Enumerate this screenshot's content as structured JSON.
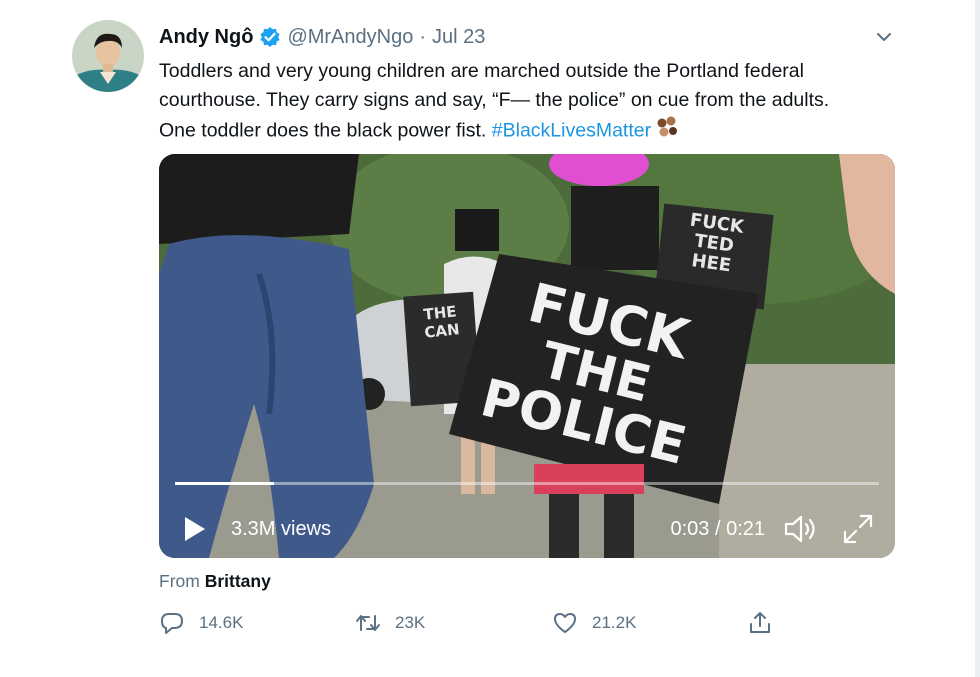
{
  "tweet": {
    "author_name": "Andy Ngô",
    "handle": "@MrAndyNgo",
    "separator": "·",
    "date": "Jul 23",
    "text_line1": "Toddlers and very young children are marched outside the Portland federal",
    "text_line2": "courthouse. They carry signs and say, “F— the police” on cue from the adults.",
    "text_line3_prefix": "One toddler does the black power fist. ",
    "hashtag": "#BlackLivesMatter",
    "emoji": "fist-emoji"
  },
  "video": {
    "sign_text_line1": "FUCK",
    "sign_text_line2": "THE",
    "sign_text_line3": "POLICE",
    "back_sign_line1": "FUCK",
    "back_sign_line2": "TED",
    "back_sign_line3": "HEE",
    "left_sign_line1": "THE",
    "left_sign_line2": "CAN",
    "progress": 0.14,
    "views": "3.3M views",
    "time": "0:03 / 0:21",
    "icons": [
      "play-icon",
      "volume-icon",
      "fullscreen-icon"
    ]
  },
  "attribution": {
    "prefix": "From ",
    "source": "Brittany"
  },
  "actions": {
    "reply_count": "14.6K",
    "retweet_count": "23K",
    "like_count": "21.2K"
  },
  "colors": {
    "hashtag": "#1b95e0",
    "verified": "#1da1f2",
    "muted": "#5b7083"
  }
}
